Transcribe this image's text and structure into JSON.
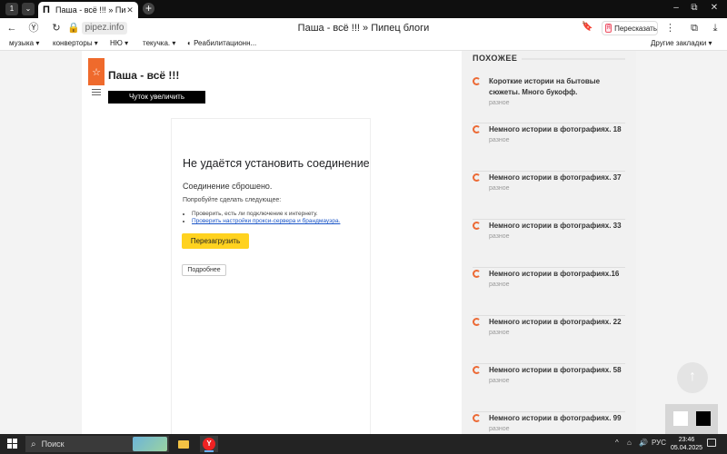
{
  "browser": {
    "tab_counter": "1",
    "tab_favicon": "П",
    "tab_title": "Паша - всё !!! » Пипец блоги",
    "tab_close": "✕",
    "new_tab": "+",
    "window_controls": {
      "min": "–",
      "restore": "⧉",
      "close": "✕"
    },
    "domain": "pipez.info",
    "page_title": "Паша - всё !!! » Пипец блоги",
    "retell_label": "Пересказать",
    "retell_logo": "Я",
    "bookmarks": [
      {
        "label": "музыка ▾"
      },
      {
        "label": "конверторы ▾"
      },
      {
        "label": "НЮ ▾"
      },
      {
        "label": "текучка. ▾"
      },
      {
        "label": "Реабилитационн..."
      }
    ],
    "other_bookmarks": "Другие закладки ▾"
  },
  "page": {
    "blog_title": "Паша - всё !!!",
    "zoom_button": "Чуток увеличить",
    "error": {
      "heading": "Не удаётся установить соединение с с",
      "subheading": "Соединение сброшено.",
      "try_label": "Попробуйте сделать следующее:",
      "items": [
        "Проверить, есть ли подключение к интернету.",
        "Проверить настройки прокси-сервера и брандмауэра."
      ],
      "reload_button": "Перезагрузить",
      "details_button": "Подробнее"
    },
    "similar": {
      "heading": "ПОХОЖЕЕ",
      "items": [
        {
          "title": "Короткие истории на бытовые сюжеты. Много букофф.",
          "category": "разное"
        },
        {
          "title": "Немного истории в фотографиях. 18",
          "category": "разное"
        },
        {
          "title": "Немного истории в фотографиях. 37",
          "category": "разное"
        },
        {
          "title": "Немного истории в фотографиях. 33",
          "category": "разное"
        },
        {
          "title": "Немного истории в фотографиях.16",
          "category": "разное"
        },
        {
          "title": "Немного истории в фотографиях. 22",
          "category": "разное"
        },
        {
          "title": "Немного истории в фотографиях. 58",
          "category": "разное"
        },
        {
          "title": "Немного истории в фотографиях. 99",
          "category": "разное"
        }
      ]
    }
  },
  "taskbar": {
    "search_label": "Поиск",
    "tray_lang": "РУС",
    "clock_time": "23:46",
    "clock_date": "05.04.2025"
  }
}
